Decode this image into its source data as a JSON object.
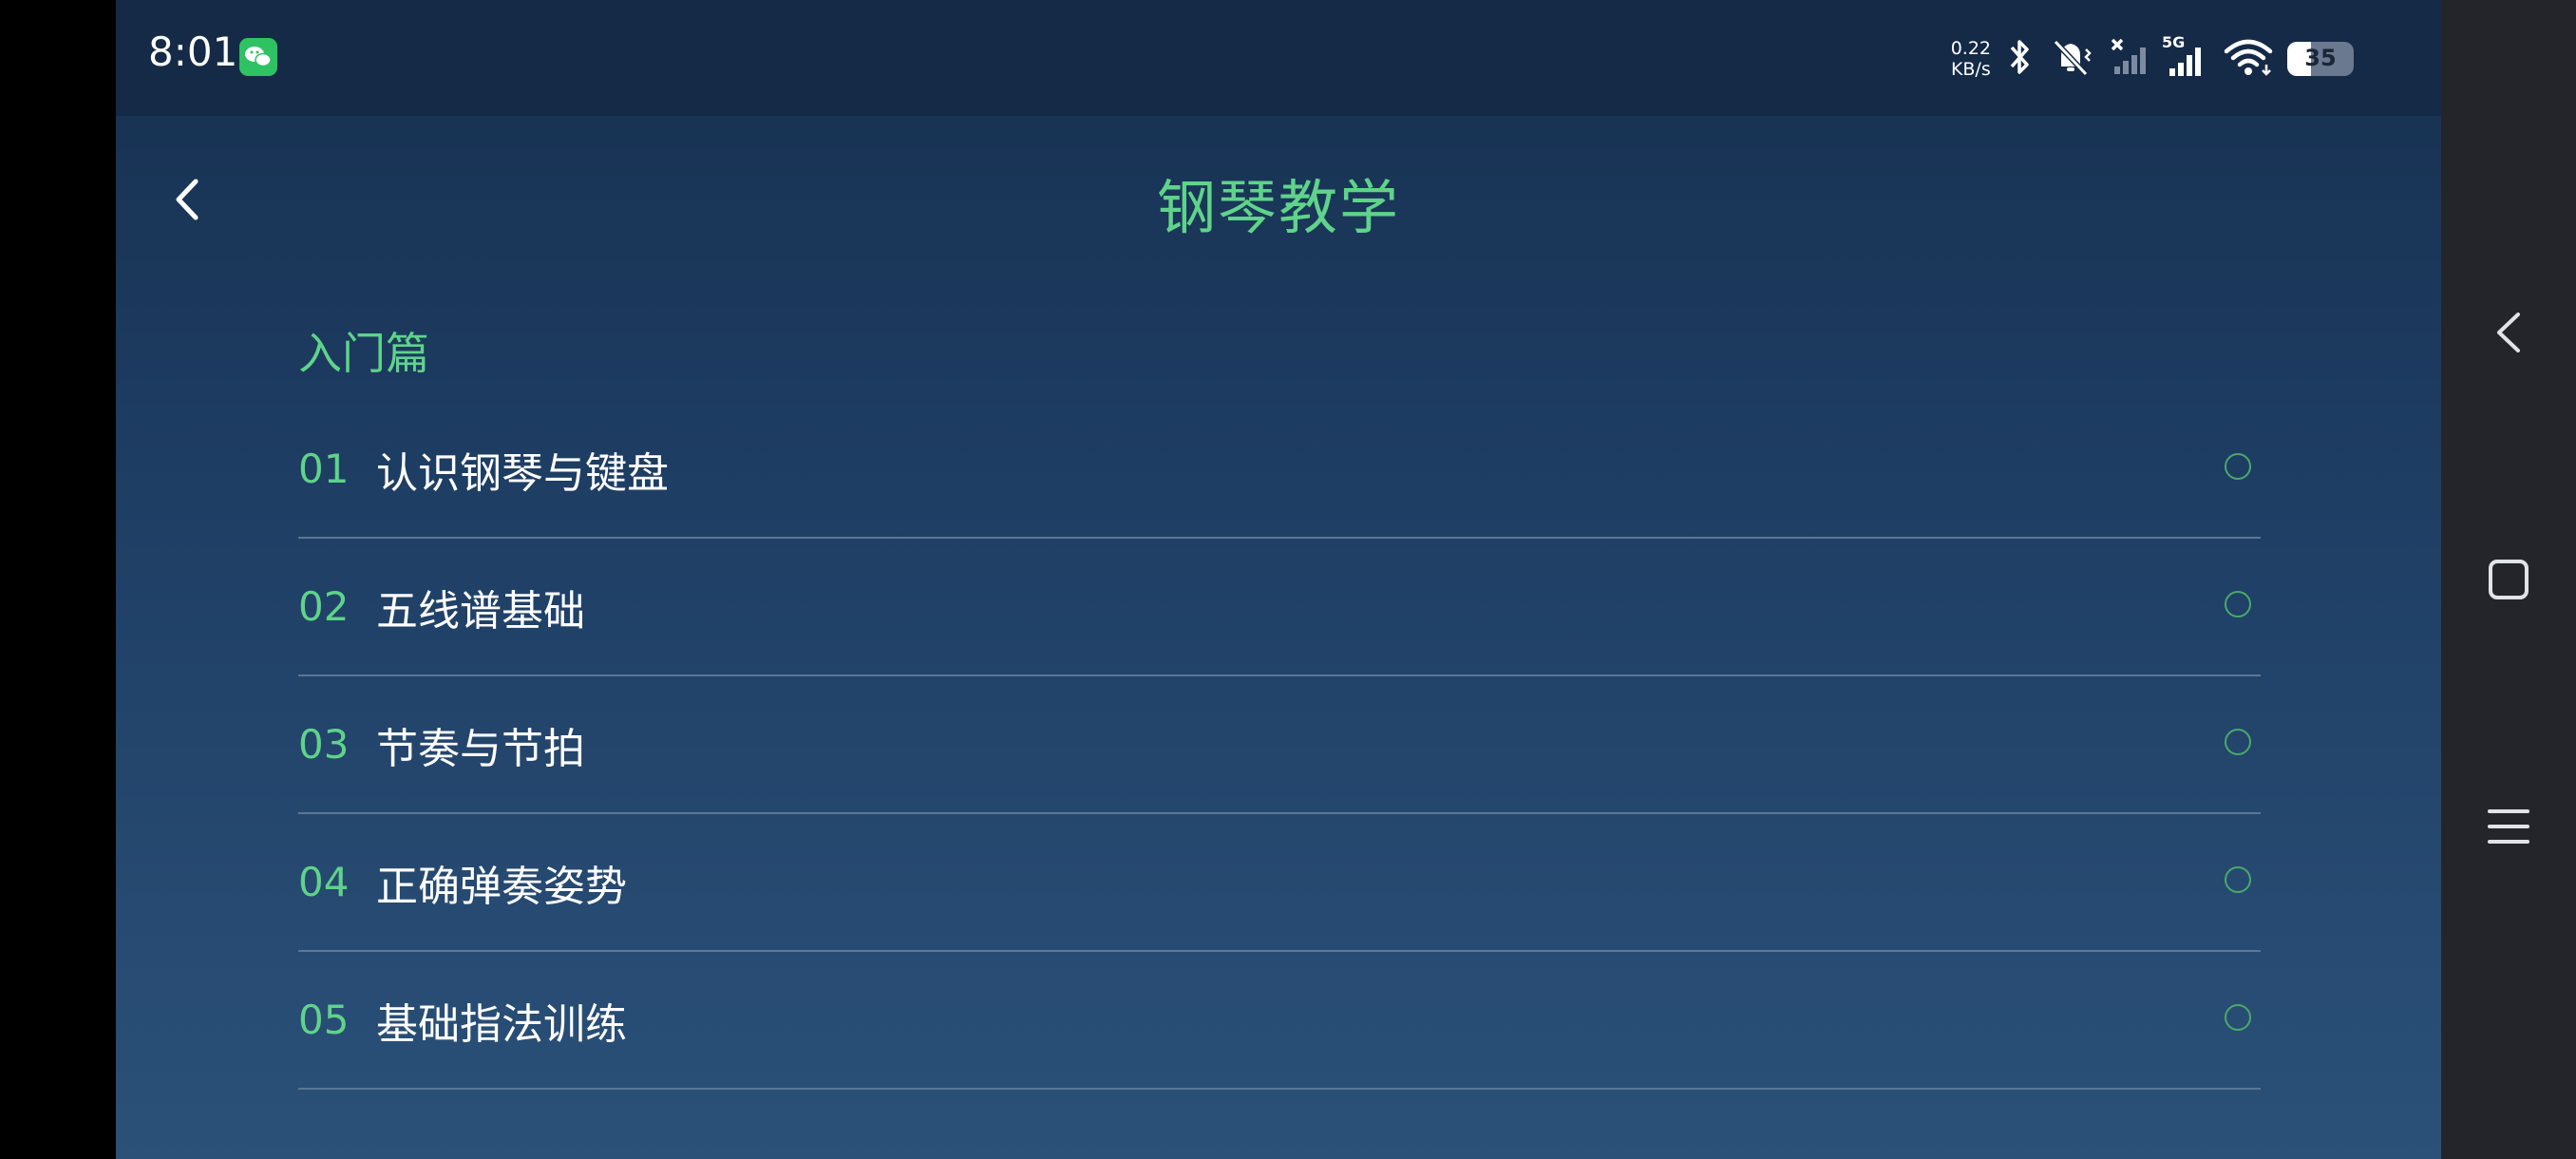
{
  "status_bar": {
    "time": "8:01",
    "net_speed_value": "0.22",
    "net_speed_unit": "KB/s",
    "network_type": "5G",
    "battery_level": "35",
    "icons": [
      "wechat-icon",
      "bluetooth-icon",
      "mute-icon",
      "signal-icon",
      "wifi-icon",
      "battery-icon"
    ]
  },
  "header": {
    "title": "钢琴教学",
    "back_icon": "back-chevron-icon"
  },
  "sections": [
    {
      "title": "入门篇",
      "lessons": [
        {
          "num": "01",
          "title": "认识钢琴与键盘"
        },
        {
          "num": "02",
          "title": "五线谱基础"
        },
        {
          "num": "03",
          "title": "节奏与节拍"
        },
        {
          "num": "04",
          "title": "正确弹奏姿势"
        },
        {
          "num": "05",
          "title": "基础指法训练"
        }
      ]
    }
  ],
  "colors": {
    "accent": "#5fd38a",
    "background_top": "#16304f",
    "background_bottom": "#2b5179",
    "divider": "#5b7795"
  }
}
